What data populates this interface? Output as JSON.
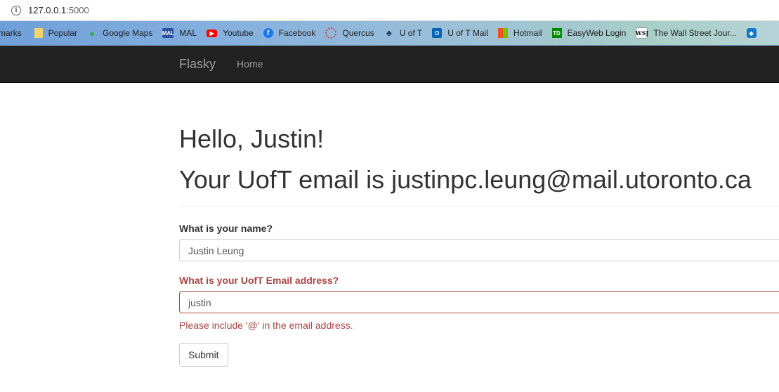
{
  "browser": {
    "url_host": "127.0.0.1",
    "url_port": ":5000",
    "bookmarks": [
      {
        "label": "marks",
        "icon": "bookmarks-icon"
      },
      {
        "label": "Popular",
        "icon": "folder-icon"
      },
      {
        "label": "Google Maps",
        "icon": "google-maps-icon"
      },
      {
        "label": "MAL",
        "icon": "mal-icon"
      },
      {
        "label": "Youtube",
        "icon": "youtube-icon"
      },
      {
        "label": "Facebook",
        "icon": "facebook-icon"
      },
      {
        "label": "Quercus",
        "icon": "quercus-icon"
      },
      {
        "label": "U of T",
        "icon": "uoft-icon"
      },
      {
        "label": "U of T Mail",
        "icon": "outlook-icon"
      },
      {
        "label": "Hotmail",
        "icon": "microsoft-icon"
      },
      {
        "label": "EasyWeb Login",
        "icon": "td-icon"
      },
      {
        "label": "The Wall Street Jour...",
        "icon": "wsj-icon"
      }
    ]
  },
  "navbar": {
    "brand": "Flasky",
    "home": "Home"
  },
  "page": {
    "greeting": "Hello, Justin!",
    "email_line": "Your UofT email is justinpc.leung@mail.utoronto.ca"
  },
  "form": {
    "name_label": "What is your name?",
    "name_value": "Justin Leung",
    "email_label": "What is your UofT Email address?",
    "email_value": "justin",
    "email_error": "Please include '@' in the email address.",
    "submit_label": "Submit"
  },
  "colors": {
    "navbar_bg": "#222222",
    "error": "#a94442"
  }
}
